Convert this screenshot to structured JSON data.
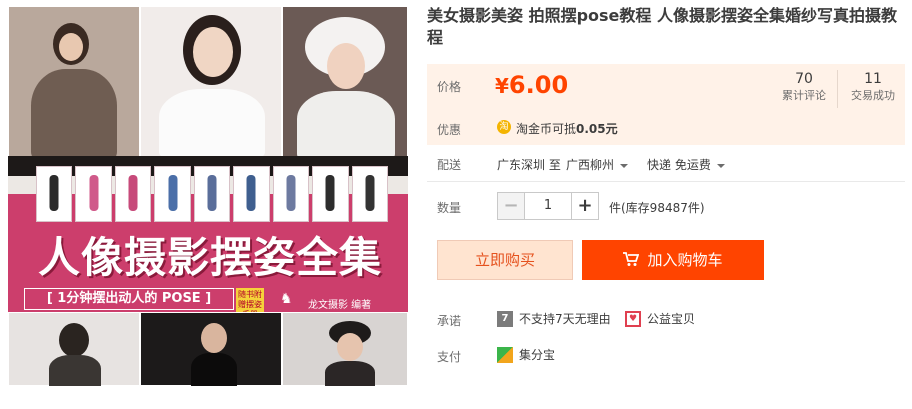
{
  "cover": {
    "title": "人像摄影摆姿全集",
    "subtitle": "[ 1分钟摆出动人的 POSE ]",
    "side_badge": "随书附赠摆姿手册",
    "author": "龙文摄影 编著"
  },
  "product": {
    "title": "美女摄影美姿 拍照摆pose教程 人像摄影摆姿全集婚纱写真拍摄教程"
  },
  "price": {
    "label": "价格",
    "currency": "¥",
    "value": "6.00",
    "reviews_count": "70",
    "reviews_label": "累计评论",
    "sales_count": "11",
    "sales_label": "交易成功"
  },
  "promo": {
    "label": "优惠",
    "icon": "淘",
    "text_prefix": "淘金币可抵",
    "amount": "0.05元"
  },
  "shipping": {
    "label": "配送",
    "from": "广东深圳 至",
    "to": "广西柳州",
    "method": "快递 免运费"
  },
  "quantity": {
    "label": "数量",
    "minus": "−",
    "value": "1",
    "plus": "+",
    "stock": "件(库存98487件)"
  },
  "actions": {
    "buy_now": "立即购买",
    "add_to_cart": "加入购物车"
  },
  "promise": {
    "label": "承诺",
    "item1_icon": "7",
    "item1": "不支持7天无理由",
    "item2": "公益宝贝"
  },
  "payment": {
    "label": "支付",
    "item1": "集分宝"
  },
  "colors": {
    "accent": "#ff4400",
    "price_bg": "#fff2e8",
    "buy_bg": "#ffe4d0",
    "cover_pink": "#cc3e6c"
  }
}
